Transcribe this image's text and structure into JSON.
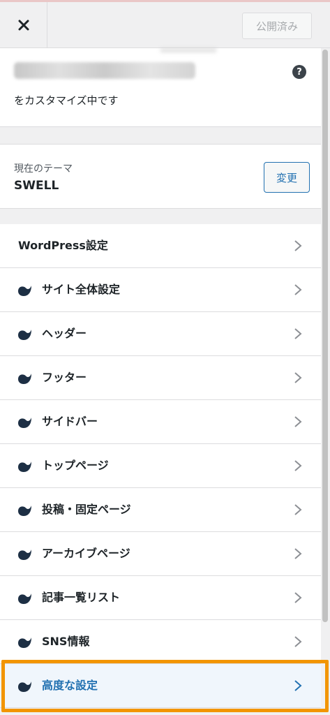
{
  "toolbar": {
    "close_label": "×",
    "publish_label": "公開済み"
  },
  "info": {
    "subtitle": "をカスタマイズ中です",
    "help": "?"
  },
  "theme": {
    "label": "現在のテーマ",
    "name": "SWELL",
    "change_label": "変更"
  },
  "menu": [
    {
      "label": "WordPress設定",
      "icon": false
    },
    {
      "label": "サイト全体設定",
      "icon": true
    },
    {
      "label": "ヘッダー",
      "icon": true
    },
    {
      "label": "フッター",
      "icon": true
    },
    {
      "label": "サイドバー",
      "icon": true
    },
    {
      "label": "トップページ",
      "icon": true
    },
    {
      "label": "投稿・固定ページ",
      "icon": true
    },
    {
      "label": "アーカイブページ",
      "icon": true
    },
    {
      "label": "記事一覧リスト",
      "icon": true
    },
    {
      "label": "SNS情報",
      "icon": true
    },
    {
      "label": "高度な設定",
      "icon": true,
      "active": true
    }
  ],
  "colors": {
    "accent": "#2271b1",
    "highlight": "#f29500",
    "logo": "#1d2f44"
  },
  "icons": {
    "close": "close-icon",
    "help": "help-icon",
    "chevron": "chevron-right-icon",
    "logo": "swell-logo-icon"
  }
}
